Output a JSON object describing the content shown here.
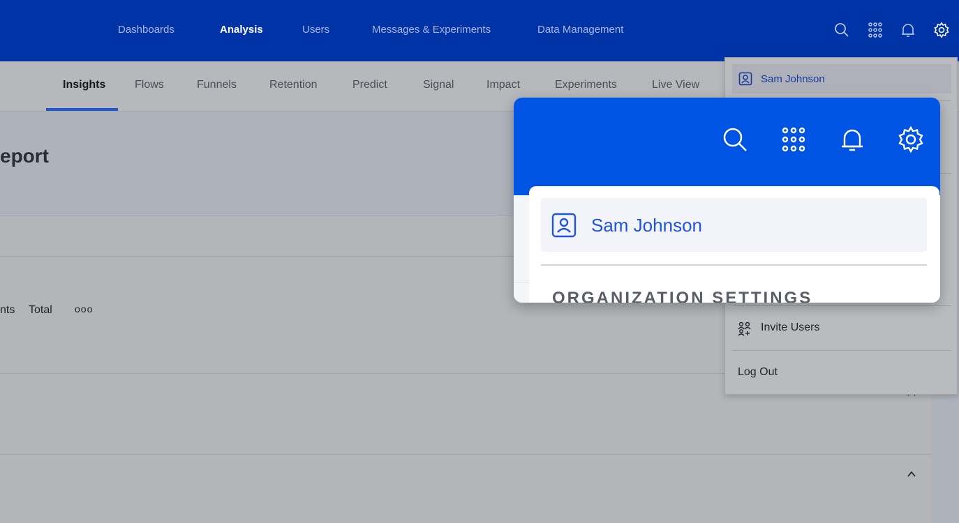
{
  "top_nav": {
    "items": [
      {
        "label": "Dashboards"
      },
      {
        "label": "Analysis",
        "active": true
      },
      {
        "label": "Users"
      },
      {
        "label": "Messages & Experiments"
      },
      {
        "label": "Data Management"
      }
    ],
    "icons": [
      "search-icon",
      "apps-grid-icon",
      "bell-icon",
      "gear-icon"
    ]
  },
  "sub_nav": {
    "items": [
      {
        "label": "Insights",
        "active": true
      },
      {
        "label": "Flows"
      },
      {
        "label": "Funnels"
      },
      {
        "label": "Retention"
      },
      {
        "label": "Predict"
      },
      {
        "label": "Signal"
      },
      {
        "label": "Impact"
      },
      {
        "label": "Experiments"
      },
      {
        "label": "Live View"
      }
    ]
  },
  "report": {
    "title_fragment": "eport",
    "toolbar": {
      "label_fragment": "nts",
      "total_label": "Total",
      "more_label": "ooo"
    }
  },
  "settings_menu": {
    "user_name": "Sam Johnson",
    "invite_label": "Invite Users",
    "logout_label": "Log Out"
  },
  "zoom_lens": {
    "user_name": "Sam Johnson",
    "section_heading": "ORGANIZATION SETTINGS"
  },
  "colors": {
    "top_bar": "#0033a5",
    "accent": "#1e57cf",
    "lens_header": "#0054e3",
    "overlay_gray": "#b3b5b9"
  }
}
